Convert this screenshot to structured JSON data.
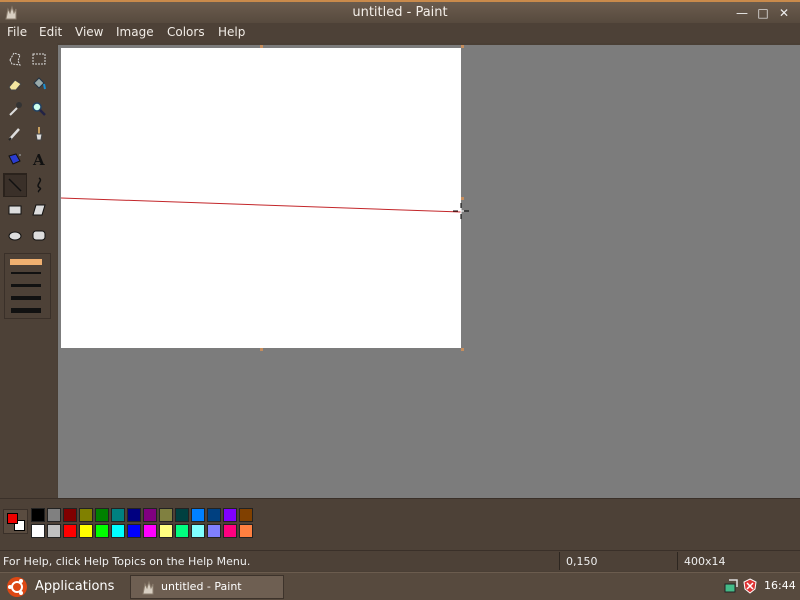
{
  "window": {
    "title": "untitled - Paint"
  },
  "menu": [
    "File",
    "Edit",
    "View",
    "Image",
    "Colors",
    "Help"
  ],
  "tools": [
    {
      "name": "free-select-icon"
    },
    {
      "name": "rect-select-icon"
    },
    {
      "name": "eraser-icon"
    },
    {
      "name": "fill-bucket-icon"
    },
    {
      "name": "color-picker-icon"
    },
    {
      "name": "magnifier-icon"
    },
    {
      "name": "pencil-icon"
    },
    {
      "name": "brush-icon"
    },
    {
      "name": "airbrush-icon"
    },
    {
      "name": "text-icon"
    },
    {
      "name": "line-icon"
    },
    {
      "name": "curve-icon"
    },
    {
      "name": "rectangle-icon"
    },
    {
      "name": "polygon-icon"
    },
    {
      "name": "ellipse-icon"
    },
    {
      "name": "rounded-rect-icon"
    }
  ],
  "active_tool": "line-icon",
  "colors": {
    "foreground": "#ee0000",
    "background": "#ffffff",
    "palette_row1": [
      "#000000",
      "#808080",
      "#800000",
      "#808000",
      "#008000",
      "#008080",
      "#000080",
      "#800080",
      "#808040",
      "#004040",
      "#0080ff",
      "#004080",
      "#8000ff",
      "#804000"
    ],
    "palette_row2": [
      "#ffffff",
      "#c0c0c0",
      "#ff0000",
      "#ffff00",
      "#00ff00",
      "#00ffff",
      "#0000ff",
      "#ff00ff",
      "#ffff80",
      "#00ff80",
      "#80ffff",
      "#8080ff",
      "#ff0080",
      "#ff8040"
    ]
  },
  "status": {
    "help": "For Help, click Help Topics on the Help Menu.",
    "position": "0,150",
    "size": "400x14"
  },
  "taskbar": {
    "applications": "Applications",
    "task": "untitled - Paint",
    "clock": "16:44"
  }
}
